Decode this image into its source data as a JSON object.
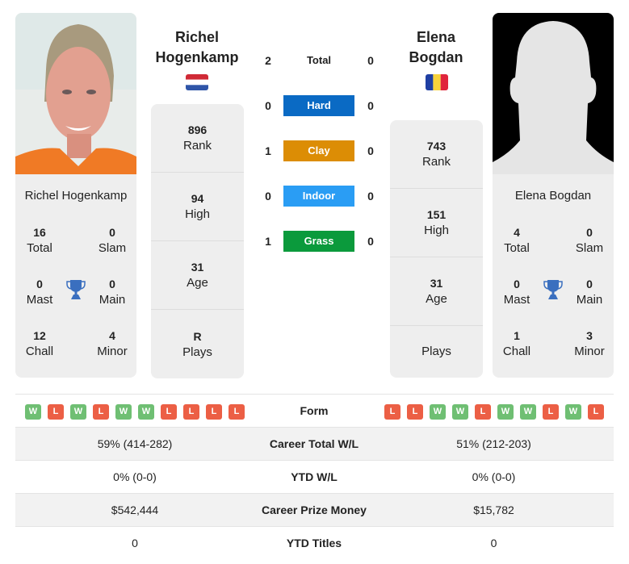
{
  "colors": {
    "hard": "#0a6ac4",
    "clay": "#dc8d05",
    "indoor": "#2a9df4",
    "grass": "#0b9a3c",
    "win": "#6fbf73",
    "loss": "#ec5f45",
    "trophy": "#3a6fbf"
  },
  "player1": {
    "name_line1": "Richel",
    "name_line2": "Hogenkamp",
    "full_name": "Richel Hogenkamp",
    "country": "Netherlands",
    "flag_icon": "netherlands-flag-icon",
    "photo": "player-photo",
    "titles": {
      "total": {
        "value": "16",
        "label": "Total"
      },
      "slam": {
        "value": "0",
        "label": "Slam"
      },
      "mast": {
        "value": "0",
        "label": "Mast"
      },
      "main": {
        "value": "0",
        "label": "Main"
      },
      "chall": {
        "value": "12",
        "label": "Chall"
      },
      "minor": {
        "value": "4",
        "label": "Minor"
      }
    },
    "stats": {
      "rank": {
        "value": "896",
        "label": "Rank"
      },
      "high": {
        "value": "94",
        "label": "High"
      },
      "age": {
        "value": "31",
        "label": "Age"
      },
      "plays": {
        "value": "R",
        "label": "Plays"
      }
    },
    "form": [
      "W",
      "L",
      "W",
      "L",
      "W",
      "W",
      "L",
      "L",
      "L",
      "L"
    ],
    "career_wl": "59% (414-282)",
    "ytd_wl": "0% (0-0)",
    "prize_money": "$542,444",
    "ytd_titles": "0"
  },
  "player2": {
    "name_line1": "Elena",
    "name_line2": "Bogdan",
    "full_name": "Elena Bogdan",
    "country": "Romania",
    "flag_icon": "romania-flag-icon",
    "photo": "placeholder-silhouette",
    "titles": {
      "total": {
        "value": "4",
        "label": "Total"
      },
      "slam": {
        "value": "0",
        "label": "Slam"
      },
      "mast": {
        "value": "0",
        "label": "Mast"
      },
      "main": {
        "value": "0",
        "label": "Main"
      },
      "chall": {
        "value": "1",
        "label": "Chall"
      },
      "minor": {
        "value": "3",
        "label": "Minor"
      }
    },
    "stats": {
      "rank": {
        "value": "743",
        "label": "Rank"
      },
      "high": {
        "value": "151",
        "label": "High"
      },
      "age": {
        "value": "31",
        "label": "Age"
      },
      "plays": {
        "value": "",
        "label": "Plays"
      }
    },
    "form": [
      "L",
      "L",
      "W",
      "W",
      "L",
      "W",
      "W",
      "L",
      "W",
      "L"
    ],
    "career_wl": "51% (212-203)",
    "ytd_wl": "0% (0-0)",
    "prize_money": "$15,782",
    "ytd_titles": "0"
  },
  "h2h": {
    "total": {
      "label": "Total",
      "p1": "2",
      "p2": "0"
    },
    "hard": {
      "label": "Hard",
      "p1": "0",
      "p2": "0"
    },
    "clay": {
      "label": "Clay",
      "p1": "1",
      "p2": "0"
    },
    "indoor": {
      "label": "Indoor",
      "p1": "0",
      "p2": "0"
    },
    "grass": {
      "label": "Grass",
      "p1": "1",
      "p2": "0"
    }
  },
  "table_labels": {
    "form": "Form",
    "career_wl": "Career Total W/L",
    "ytd_wl": "YTD W/L",
    "prize_money": "Career Prize Money",
    "ytd_titles": "YTD Titles"
  }
}
